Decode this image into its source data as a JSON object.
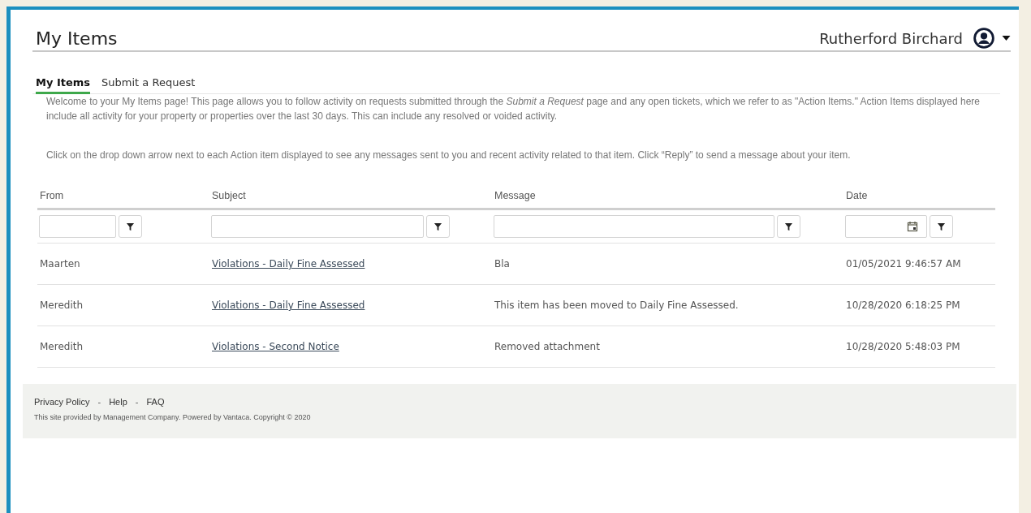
{
  "header": {
    "title": "My Items",
    "user_name": "Rutherford Birchard"
  },
  "tabs": [
    {
      "label": "My Items",
      "selected": true
    },
    {
      "label": "Submit a Request",
      "selected": false
    }
  ],
  "intro": [
    "Welcome to your My Items page! This page allows you to follow activity on requests submitted through the *Submit a Request* page and any open tickets, which we refer to as \"Action Items.\"  Action Items displayed here include all activity for your property or properties over the last 30 days.  This can include any resolved or voided activity.",
    "Click on the drop down arrow next to each  Action item displayed to see any messages sent to you and recent activity related to that item. Click “Reply” to send a message about your item."
  ],
  "table": {
    "columns": [
      {
        "label": "From",
        "kind": "text"
      },
      {
        "label": "Subject",
        "kind": "text"
      },
      {
        "label": "Message",
        "kind": "text"
      },
      {
        "label": "Date",
        "kind": "date"
      }
    ],
    "rows": [
      {
        "from": "Maarten",
        "subject": "Violations - Daily Fine Assessed",
        "message": "Bla",
        "date": "01/05/2021 9:46:57 AM"
      },
      {
        "from": "Meredith",
        "subject": "Violations - Daily Fine Assessed",
        "message": "This item has been moved to Daily Fine Assessed.",
        "date": "10/28/2020 6:18:25 PM"
      },
      {
        "from": "Meredith",
        "subject": "Violations - Second Notice",
        "message": "Removed attachment",
        "date": "10/28/2020 5:48:03 PM"
      }
    ]
  },
  "footer": {
    "links": [
      "Privacy Policy",
      "Help",
      "FAQ"
    ],
    "separator": "-",
    "notice": "This site provided by Management Company. Powered by Vantaca. Copyright © 2020"
  }
}
